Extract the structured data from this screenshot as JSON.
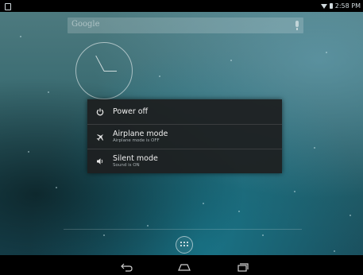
{
  "status_bar": {
    "time": "2:58 PM",
    "icons": [
      "notification-icon",
      "wifi-icon",
      "battery-icon"
    ]
  },
  "search_bar": {
    "label": "Google",
    "icon": "mic-icon"
  },
  "clock": {
    "type": "analog"
  },
  "power_dialog": {
    "items": [
      {
        "icon": "power-icon",
        "title": "Power off",
        "subtitle": ""
      },
      {
        "icon": "airplane-icon",
        "title": "Airplane mode",
        "subtitle": "Airplane mode is OFF"
      },
      {
        "icon": "volume-icon",
        "title": "Silent mode",
        "subtitle": "Sound is ON"
      }
    ]
  },
  "navigation_bar": {
    "buttons": [
      "back-icon",
      "home-icon",
      "recents-icon"
    ]
  },
  "colors": {
    "dialog_bg": "#1e2021",
    "wallpaper_top": "#4d7a7f",
    "wallpaper_bottom": "#1a4e5c"
  }
}
